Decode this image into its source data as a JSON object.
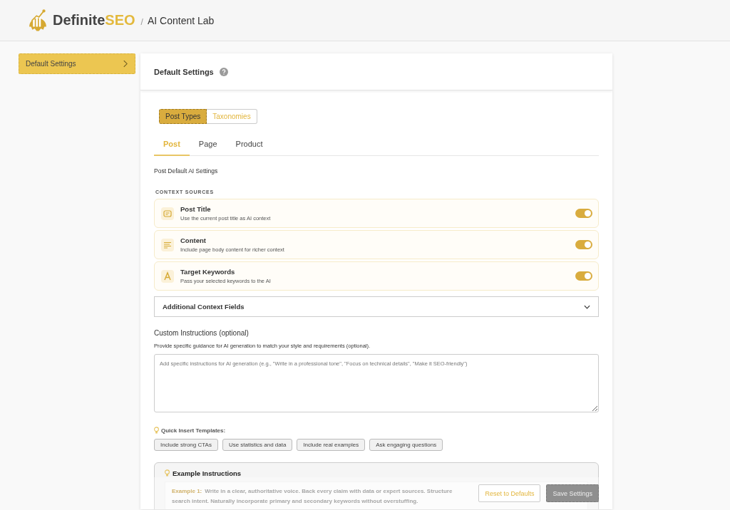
{
  "header": {
    "brand_dark": "Definite",
    "brand_accent": "SEO",
    "separator": "/",
    "product": "AI Content Lab"
  },
  "sidebar": {
    "items": [
      {
        "label": "Default Settings",
        "selected": true
      }
    ]
  },
  "panel": {
    "title": "Default Settings",
    "segments": [
      {
        "label": "Post Types",
        "selected": true
      },
      {
        "label": "Taxonomies",
        "selected": false
      }
    ],
    "tabs": [
      {
        "label": "Post",
        "selected": true
      },
      {
        "label": "Page",
        "selected": false
      },
      {
        "label": "Product",
        "selected": false
      }
    ],
    "section_title": "Post Default AI Settings",
    "context_heading": "CONTEXT SOURCES",
    "context_sources": [
      {
        "kind": "title",
        "title": "Post Title",
        "description": "Use the current post title as AI context",
        "on": true
      },
      {
        "kind": "content",
        "title": "Content",
        "description": "Include page body content for richer context",
        "on": true
      },
      {
        "kind": "keywords",
        "title": "Target Keywords",
        "description": "Pass your selected keywords to the AI",
        "on": true
      }
    ],
    "additional_fields": {
      "label": "Additional Context Fields",
      "expanded": false
    },
    "custom_instructions": {
      "label": "Custom Instructions (optional)",
      "help": "Provide specific guidance for AI generation to match your style and requirements (optional).",
      "placeholder": "Add specific instructions for AI generation (e.g., \"Write in a professional tone\", \"Focus on technical details\", \"Make it SEO-friendly\")"
    },
    "templates_label": "Quick Insert Templates:",
    "templates": [
      "Include strong CTAs",
      "Use statistics and data",
      "Include real examples",
      "Ask engaging questions"
    ],
    "examples": {
      "title": "Example Instructions",
      "items": [
        {
          "label": "Example 1:",
          "line_1": "Write in a clear, authoritative voice. Back every claim with data or expert sources. Structure",
          "line_2": "search intent. Naturally incorporate primary and secondary keywords without overstuffing."
        }
      ]
    }
  },
  "footer": {
    "buttons": [
      {
        "kind": "secondary",
        "label": "Reset to Defaults"
      },
      {
        "kind": "primary",
        "label": "Save Settings"
      }
    ]
  }
}
